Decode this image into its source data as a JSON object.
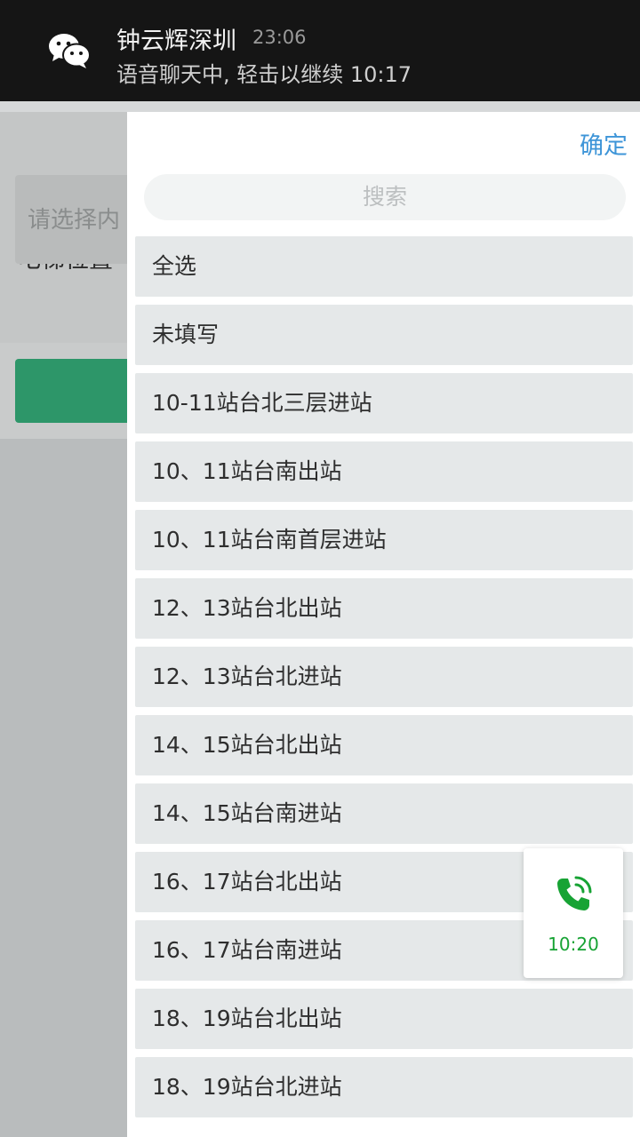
{
  "notification": {
    "title": "钟云辉深圳",
    "time": "23:06",
    "text": "语音聊天中, 轻击以继续    10:17",
    "icon": "wechat-icon"
  },
  "background": {
    "field_label": "电梯位置",
    "input_placeholder": "请选择内",
    "button_color": "#2d9669"
  },
  "drawer": {
    "confirm_label": "确定",
    "search_placeholder": "搜索",
    "items": [
      {
        "label": "全选"
      },
      {
        "label": "未填写"
      },
      {
        "label": "10-11站台北三层进站"
      },
      {
        "label": "10、11站台南出站"
      },
      {
        "label": "10、11站台南首层进站"
      },
      {
        "label": "12、13站台北出站"
      },
      {
        "label": "12、13站台北进站"
      },
      {
        "label": "14、15站台北出站"
      },
      {
        "label": "14、15站台南进站"
      },
      {
        "label": "16、17站台北出站"
      },
      {
        "label": "16、17站台南进站"
      },
      {
        "label": "18、19站台北出站"
      },
      {
        "label": "18、19站台北进站"
      }
    ]
  },
  "call_widget": {
    "time": "10:20",
    "icon": "phone-icon",
    "color": "#17a334"
  }
}
